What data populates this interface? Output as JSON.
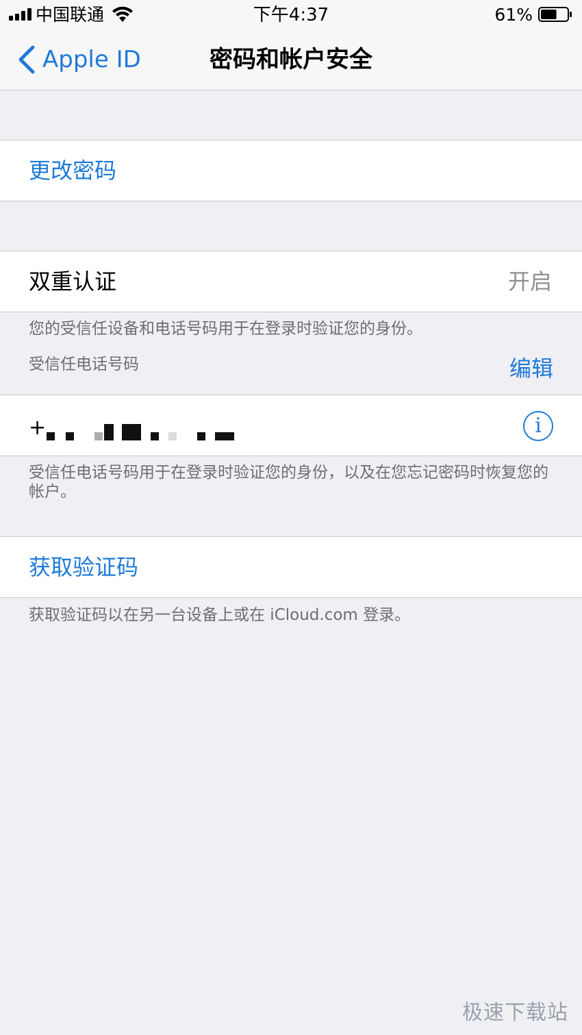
{
  "status_bar": {
    "carrier": "中国联通",
    "time": "下午4:37",
    "battery": "61%",
    "battery_level": 0.61
  },
  "nav": {
    "back_label": "Apple ID",
    "title": "密码和帐户安全"
  },
  "change_password": {
    "label": "更改密码"
  },
  "two_factor": {
    "label": "双重认证",
    "value": "开启",
    "description": "您的受信任设备和电话号码用于在登录时验证您的身份。",
    "trusted_header": "受信任电话号码",
    "edit_label": "编辑",
    "phone_prefix": "+",
    "phone_footer": "受信任电话号码用于在登录时验证您的身份，以及在您忘记密码时恢复您的帐户。"
  },
  "verification": {
    "label": "获取验证码",
    "footer": "获取验证码以在另一台设备上或在 iCloud.com 登录。"
  },
  "watermark": "极速下载站",
  "colors": {
    "accent": "#1f7ad8",
    "background": "#efeff4",
    "footer_text": "#6d6d72"
  },
  "icons": {
    "back": "chevron-left-icon",
    "info": "info-circle-icon",
    "wifi": "wifi-icon",
    "signal": "signal-icon",
    "battery": "battery-icon"
  }
}
